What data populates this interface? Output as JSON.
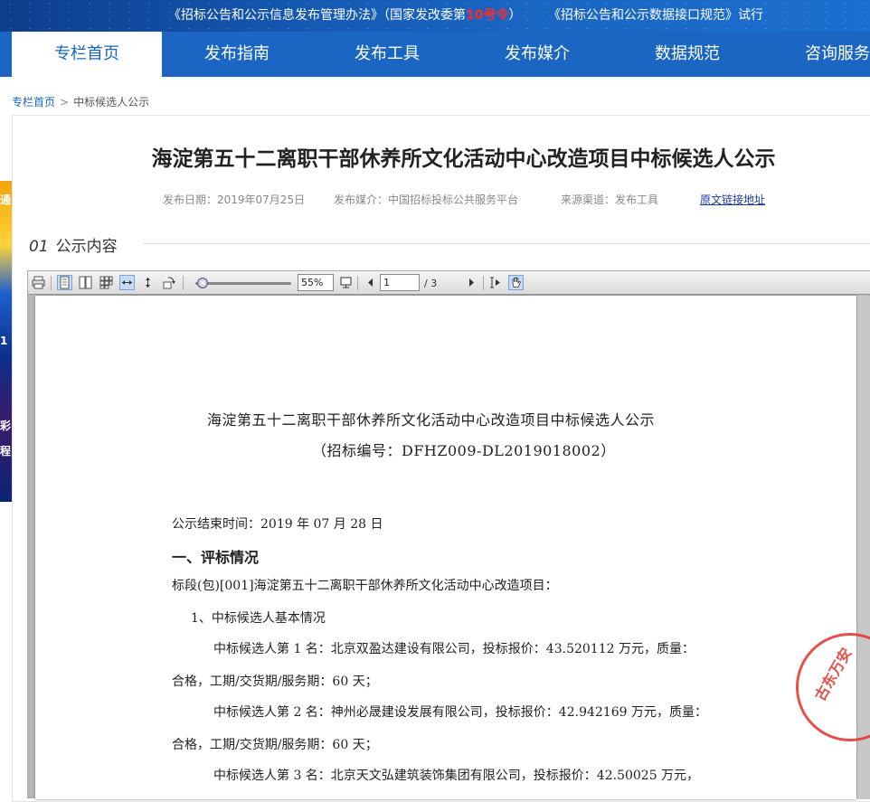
{
  "banner": {
    "notice1_pre": "《招标公告和公示信息发布管理办法》（国家发改委第",
    "notice1_num": "10号令",
    "notice1_post": "）",
    "notice2": "《招标公告和公示数据接口规范》试行"
  },
  "nav": {
    "tabs": [
      "专栏首页",
      "发布指南",
      "发布工具",
      "发布媒介",
      "数据规范",
      "咨询服务"
    ],
    "active": 0
  },
  "left_banner": {
    "glyphs": [
      "通",
      "1",
      "彩",
      "程"
    ]
  },
  "breadcrumb": {
    "home": "专栏首页",
    "separator": ">",
    "current": "中标候选人公示"
  },
  "article": {
    "title": "海淀第五十二离职干部休养所文化活动中心改造项目中标候选人公示",
    "date": "发布日期：2019年07月25日",
    "media": "发布媒介：中国招标投标公共服务平台",
    "channel": "来源渠道：发布工具",
    "source_link": "原文链接地址"
  },
  "section": {
    "number": "01",
    "title": "公示内容"
  },
  "viewer": {
    "zoom": "55%",
    "page_current": "1",
    "page_total": "/ 3",
    "tools": [
      "print-icon",
      "single-page-icon",
      "two-page-icon",
      "grid-page-icon",
      "fit-width-icon",
      "fit-height-icon",
      "rotate-icon",
      "page-view-icon",
      "prev-page-icon",
      "next-page-icon",
      "text-select-icon",
      "hand-tool-icon"
    ]
  },
  "document": {
    "title": "海淀第五十二离职干部休养所文化活动中心改造项目中标候选人公示",
    "code": "（招标编号：DFHZ009-DL2019018002）",
    "end_time": "公示结束时间：2019 年 07 月 28 日",
    "heading1": "一、评标情况",
    "section_line": "标段(包)[001]海淀第五十二离职干部休养所文化活动中心改造项目：",
    "sub1": "1、中标候选人基本情况",
    "c1_line1": "中标候选人第 1 名：北京双盈达建设有限公司，投标报价：43.520112 万元，质量：",
    "c1_line2": "合格，工期/交货期/服务期：60 天；",
    "c2_line1": "中标候选人第 2 名：神州必晟建设发展有限公司，投标报价：42.942169 万元，质量：",
    "c2_line2": "合格，工期/交货期/服务期：60 天；",
    "c3_line1": "中标候选人第 3 名：北京天文弘建筑装饰集团有限公司，投标报价：42.50025 万元，",
    "seal_text": "古东万安"
  },
  "colors": {
    "brand_blue": "#1a66c2",
    "highlight_red": "#ff2a2a",
    "seal_red": "#e0322d"
  }
}
